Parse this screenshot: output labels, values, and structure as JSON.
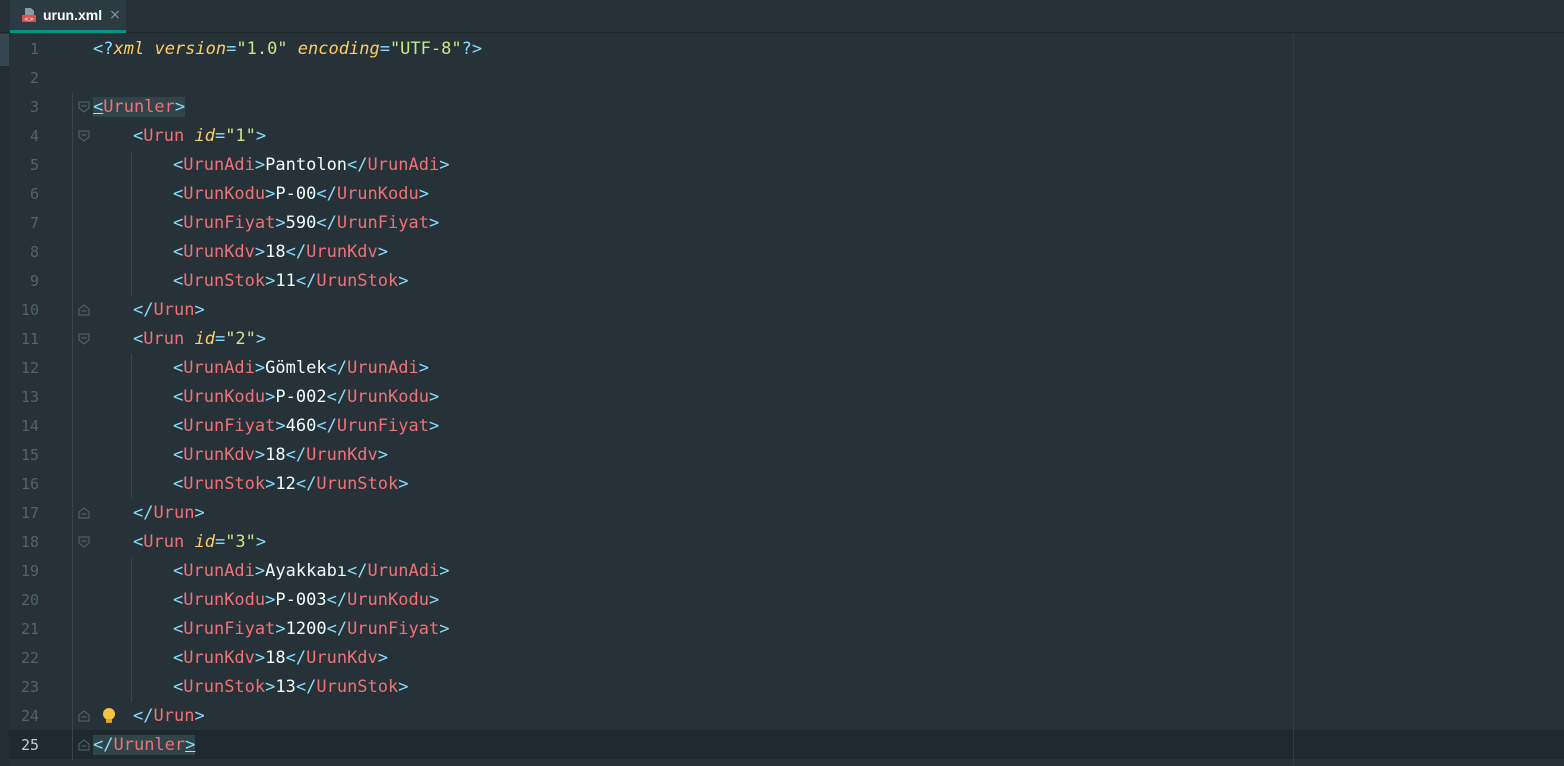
{
  "tab": {
    "file_name": "urun.xml",
    "close": "×",
    "icon": "xml-file-icon"
  },
  "editor": {
    "line_numbers": [
      "1",
      "2",
      "3",
      "4",
      "5",
      "6",
      "7",
      "8",
      "9",
      "10",
      "11",
      "12",
      "13",
      "14",
      "15",
      "16",
      "17",
      "18",
      "19",
      "20",
      "21",
      "22",
      "23",
      "24",
      "25"
    ],
    "current_line": 25,
    "declaration": {
      "open": "<?",
      "name": "xml",
      "attr1": "version",
      "val1": "\"1.0\"",
      "attr2": "encoding",
      "val2": "\"UTF-8\"",
      "close": "?>"
    },
    "root_tag": "Urunler",
    "item_tag": "Urun",
    "id_attr": "id",
    "products": [
      {
        "id": "\"1\"",
        "UrunAdi": "Pantolon",
        "UrunKodu": "P-00",
        "UrunFiyat": "590",
        "UrunKdv": "18",
        "UrunStok": "11"
      },
      {
        "id": "\"2\"",
        "UrunAdi": "Gömlek",
        "UrunKodu": "P-002",
        "UrunFiyat": "460",
        "UrunKdv": "18",
        "UrunStok": "12"
      },
      {
        "id": "\"3\"",
        "UrunAdi": "Ayakkabı",
        "UrunKodu": "P-003",
        "UrunFiyat": "1200",
        "UrunKdv": "18",
        "UrunStok": "13"
      }
    ],
    "fields": [
      "UrunAdi",
      "UrunKodu",
      "UrunFiyat",
      "UrunKdv",
      "UrunStok"
    ],
    "icons": [
      "fold-icon",
      "lightbulb-icon"
    ]
  },
  "colors": {
    "background": "#263238",
    "tab_accent": "#009688",
    "tag": "#f07178",
    "punctuation": "#89ddff",
    "attribute": "#ffcb6b",
    "string": "#c3e88d",
    "text": "#eeffff"
  }
}
